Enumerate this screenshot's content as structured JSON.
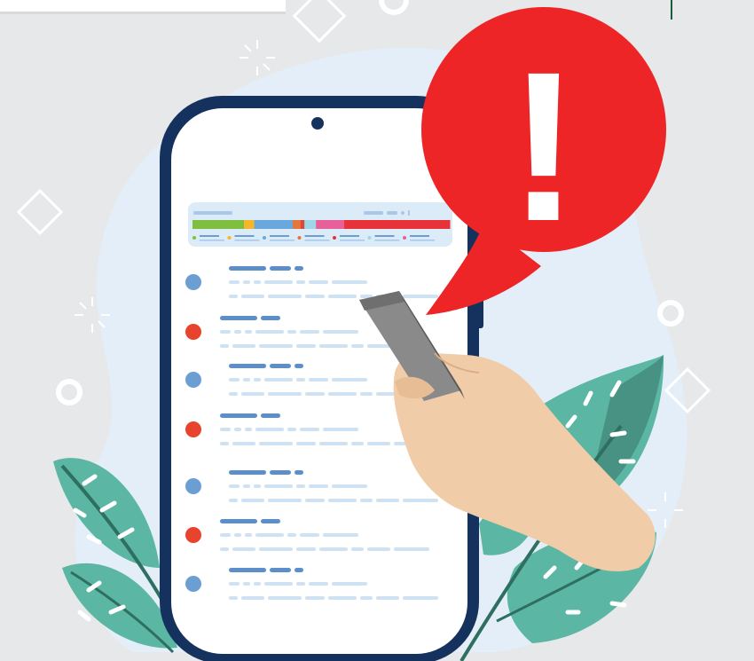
{
  "illustration": {
    "subject": "smartphone-notification-alert",
    "alert_symbol": "!",
    "colors": {
      "background": "#e7e8e9",
      "blob": "#e3eef8",
      "phone_frame": "#15325e",
      "screen": "#ffffff",
      "alert_red": "#ee2526",
      "dot_blue": "#6b9fd4",
      "dot_red": "#e8432c",
      "leaf_green": "#5bb7a3",
      "leaf_dark": "#479283",
      "skin": "#f0cda8",
      "handheld_phone": "#8a8a8a"
    },
    "status_bar_segments": [
      {
        "color": "#7fbf3f",
        "share": 0.2
      },
      {
        "color": "#f5b72a",
        "share": 0.04
      },
      {
        "color": "#6aa7dc",
        "share": 0.15
      },
      {
        "color": "#e7763a",
        "share": 0.03
      },
      {
        "color": "#d64b3b",
        "share": 0.015
      },
      {
        "color": "#9ed7e8",
        "share": 0.045
      },
      {
        "color": "#e8609a",
        "share": 0.11
      },
      {
        "color": "#e8323a",
        "share": 0.41
      }
    ],
    "list_item_status": [
      "blue",
      "red",
      "blue",
      "red",
      "blue",
      "red",
      "blue"
    ]
  }
}
